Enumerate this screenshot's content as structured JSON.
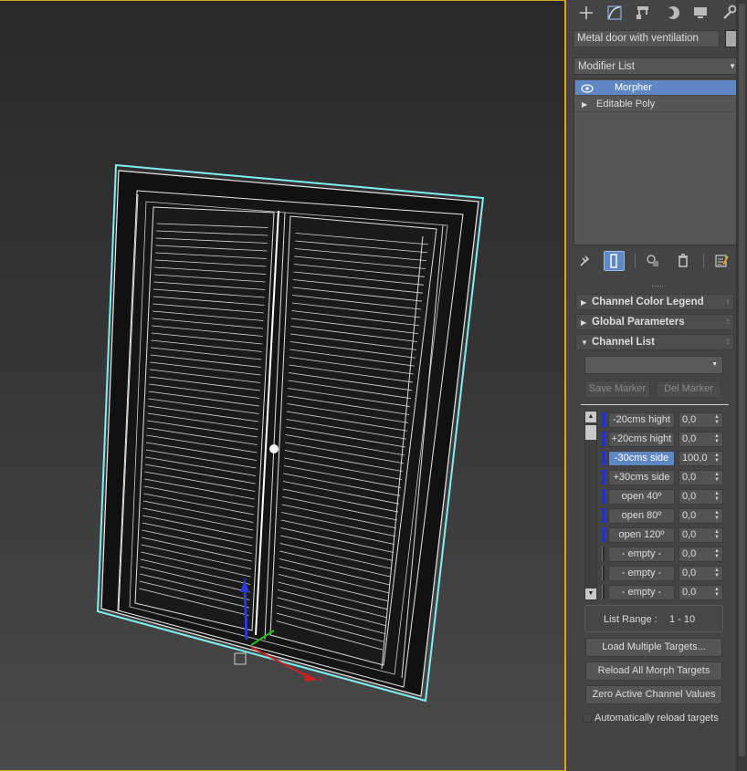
{
  "command_panel": {
    "tabs": [
      {
        "name": "create-tab",
        "icon": "plus-icon"
      },
      {
        "name": "modify-tab",
        "icon": "modify-curve-icon"
      },
      {
        "name": "hierarchy-tab",
        "icon": "hierarchy-icon"
      },
      {
        "name": "motion-tab",
        "icon": "motion-icon"
      },
      {
        "name": "display-tab",
        "icon": "monitor-icon"
      },
      {
        "name": "utilities-tab",
        "icon": "wrench-icon"
      }
    ],
    "object_name": "Metal door with ventilation",
    "object_color": "#a8a8a8",
    "modifier_list_label": "Modifier List",
    "stack": [
      {
        "label": "Morpher",
        "selected": true,
        "icon": "eye-icon"
      },
      {
        "label": "Editable Poly",
        "selected": false,
        "icon": "expand-triangle-icon"
      }
    ]
  },
  "rollouts": {
    "color_legend": "Channel Color Legend",
    "global_params": "Global Parameters",
    "channel_list": "Channel List"
  },
  "channel_list": {
    "save_marker": "Save Marker",
    "del_marker": "Del Marker",
    "channels": [
      {
        "name": "-20cms hight",
        "value": "0,0",
        "active": false,
        "empty": false
      },
      {
        "name": "+20cms hight",
        "value": "0,0",
        "active": false,
        "empty": false
      },
      {
        "name": "-30cms side",
        "value": "100,0",
        "active": true,
        "empty": false
      },
      {
        "name": "+30cms side",
        "value": "0,0",
        "active": false,
        "empty": false
      },
      {
        "name": "open 40º",
        "value": "0,0",
        "active": false,
        "empty": false
      },
      {
        "name": "open 80º",
        "value": "0,0",
        "active": false,
        "empty": false
      },
      {
        "name": "open 120º",
        "value": "0,0",
        "active": false,
        "empty": false
      },
      {
        "name": "- empty -",
        "value": "0,0",
        "active": false,
        "empty": true
      },
      {
        "name": "- empty -",
        "value": "0,0",
        "active": false,
        "empty": true
      },
      {
        "name": "- empty -",
        "value": "0,0",
        "active": false,
        "empty": true
      }
    ],
    "list_range_label": "List Range :",
    "list_range_value": "1 - 10",
    "load_multiple": "Load Multiple Targets...",
    "reload_all": "Reload All Morph Targets",
    "zero_active": "Zero Active Channel Values",
    "auto_reload_label": "Automatically reload targets",
    "auto_reload_checked": false
  },
  "viewport": {
    "gizmo_labels": {
      "x": "x",
      "z": "z"
    }
  }
}
